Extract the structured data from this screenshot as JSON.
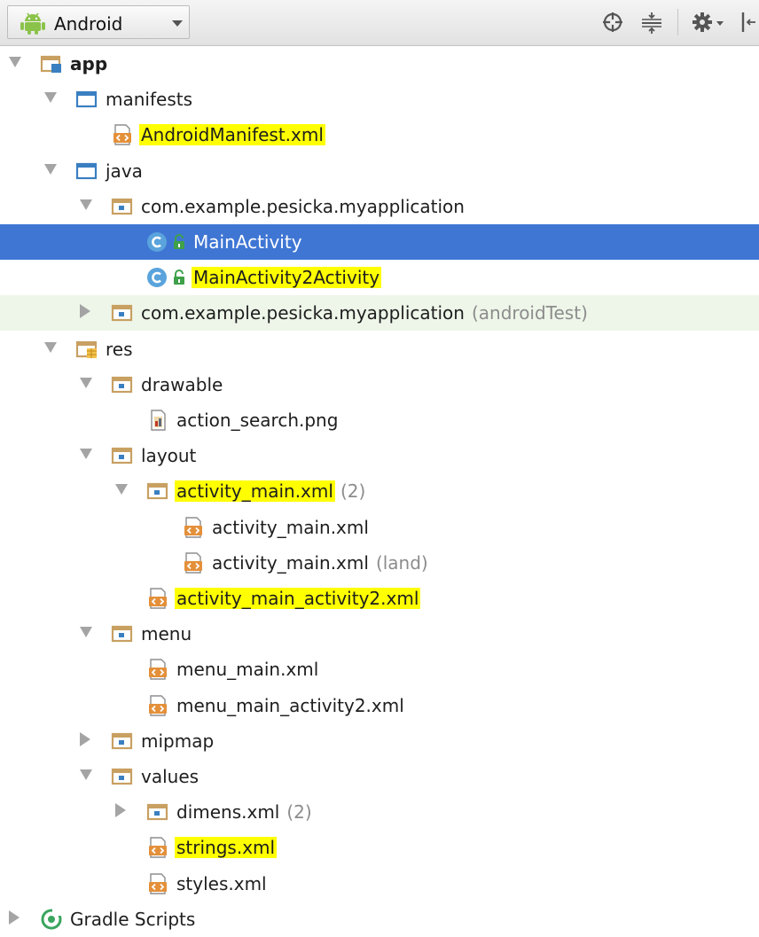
{
  "toolbar": {
    "view_label": "Android",
    "icons": [
      "android-icon",
      "scroll-from-source-icon",
      "collapse-all-icon",
      "settings-gear-icon",
      "hide-panel-icon"
    ]
  },
  "colors": {
    "highlight": "#ffff00",
    "selection": "#3f76d4",
    "hover": "#eef6e9",
    "folder_blue": "#3a7fc1",
    "folder_tan": "#c8a062",
    "xml_orange": "#e4903a",
    "class_blue": "#5aa3dc",
    "gradle_green": "#3aa55f"
  },
  "tree": [
    {
      "label": "app",
      "suffix": "",
      "level": 0,
      "arrow": "open",
      "icon": "module",
      "bold": true,
      "highlight": false,
      "state": ""
    },
    {
      "label": "manifests",
      "suffix": "",
      "level": 1,
      "arrow": "open",
      "icon": "folder-blue",
      "bold": false,
      "highlight": false,
      "state": ""
    },
    {
      "label": "AndroidManifest.xml",
      "suffix": "",
      "level": 2,
      "arrow": "",
      "icon": "xml",
      "bold": false,
      "highlight": true,
      "state": ""
    },
    {
      "label": "java",
      "suffix": "",
      "level": 1,
      "arrow": "open",
      "icon": "folder-blue",
      "bold": false,
      "highlight": false,
      "state": ""
    },
    {
      "label": "com.example.pesicka.myapplication",
      "suffix": "",
      "level": 2,
      "arrow": "open",
      "icon": "package",
      "bold": false,
      "highlight": false,
      "state": ""
    },
    {
      "label": "MainActivity",
      "suffix": "",
      "level": 3,
      "arrow": "",
      "icon": "class",
      "bold": false,
      "highlight": false,
      "state": "selected"
    },
    {
      "label": "MainActivity2Activity",
      "suffix": "",
      "level": 3,
      "arrow": "",
      "icon": "class",
      "bold": false,
      "highlight": true,
      "state": ""
    },
    {
      "label": "com.example.pesicka.myapplication",
      "suffix": "(androidTest)",
      "level": 2,
      "arrow": "closed",
      "icon": "package",
      "bold": false,
      "highlight": false,
      "state": "hovered"
    },
    {
      "label": "res",
      "suffix": "",
      "level": 1,
      "arrow": "open",
      "icon": "res-folder",
      "bold": false,
      "highlight": false,
      "state": ""
    },
    {
      "label": "drawable",
      "suffix": "",
      "level": 2,
      "arrow": "open",
      "icon": "package",
      "bold": false,
      "highlight": false,
      "state": ""
    },
    {
      "label": "action_search.png",
      "suffix": "",
      "level": 3,
      "arrow": "",
      "icon": "image",
      "bold": false,
      "highlight": false,
      "state": ""
    },
    {
      "label": "layout",
      "suffix": "",
      "level": 2,
      "arrow": "open",
      "icon": "package",
      "bold": false,
      "highlight": false,
      "state": ""
    },
    {
      "label": "activity_main.xml",
      "suffix": "(2)",
      "level": 3,
      "arrow": "open",
      "icon": "package",
      "bold": false,
      "highlight": true,
      "state": ""
    },
    {
      "label": "activity_main.xml",
      "suffix": "",
      "level": 4,
      "arrow": "",
      "icon": "xml",
      "bold": false,
      "highlight": false,
      "state": ""
    },
    {
      "label": "activity_main.xml",
      "suffix": "(land)",
      "level": 4,
      "arrow": "",
      "icon": "xml",
      "bold": false,
      "highlight": false,
      "state": ""
    },
    {
      "label": "activity_main_activity2.xml",
      "suffix": "",
      "level": 3,
      "arrow": "",
      "icon": "xml",
      "bold": false,
      "highlight": true,
      "state": ""
    },
    {
      "label": "menu",
      "suffix": "",
      "level": 2,
      "arrow": "open",
      "icon": "package",
      "bold": false,
      "highlight": false,
      "state": ""
    },
    {
      "label": "menu_main.xml",
      "suffix": "",
      "level": 3,
      "arrow": "",
      "icon": "xml",
      "bold": false,
      "highlight": false,
      "state": ""
    },
    {
      "label": "menu_main_activity2.xml",
      "suffix": "",
      "level": 3,
      "arrow": "",
      "icon": "xml",
      "bold": false,
      "highlight": false,
      "state": ""
    },
    {
      "label": "mipmap",
      "suffix": "",
      "level": 2,
      "arrow": "closed",
      "icon": "package",
      "bold": false,
      "highlight": false,
      "state": ""
    },
    {
      "label": "values",
      "suffix": "",
      "level": 2,
      "arrow": "open",
      "icon": "package",
      "bold": false,
      "highlight": false,
      "state": ""
    },
    {
      "label": "dimens.xml",
      "suffix": "(2)",
      "level": 3,
      "arrow": "closed",
      "icon": "package",
      "bold": false,
      "highlight": false,
      "state": ""
    },
    {
      "label": "strings.xml",
      "suffix": "",
      "level": 3,
      "arrow": "",
      "icon": "xml",
      "bold": false,
      "highlight": true,
      "state": ""
    },
    {
      "label": "styles.xml",
      "suffix": "",
      "level": 3,
      "arrow": "",
      "icon": "xml",
      "bold": false,
      "highlight": false,
      "state": ""
    },
    {
      "label": "Gradle Scripts",
      "suffix": "",
      "level": 0,
      "arrow": "closed",
      "icon": "gradle",
      "bold": false,
      "highlight": false,
      "state": ""
    }
  ]
}
